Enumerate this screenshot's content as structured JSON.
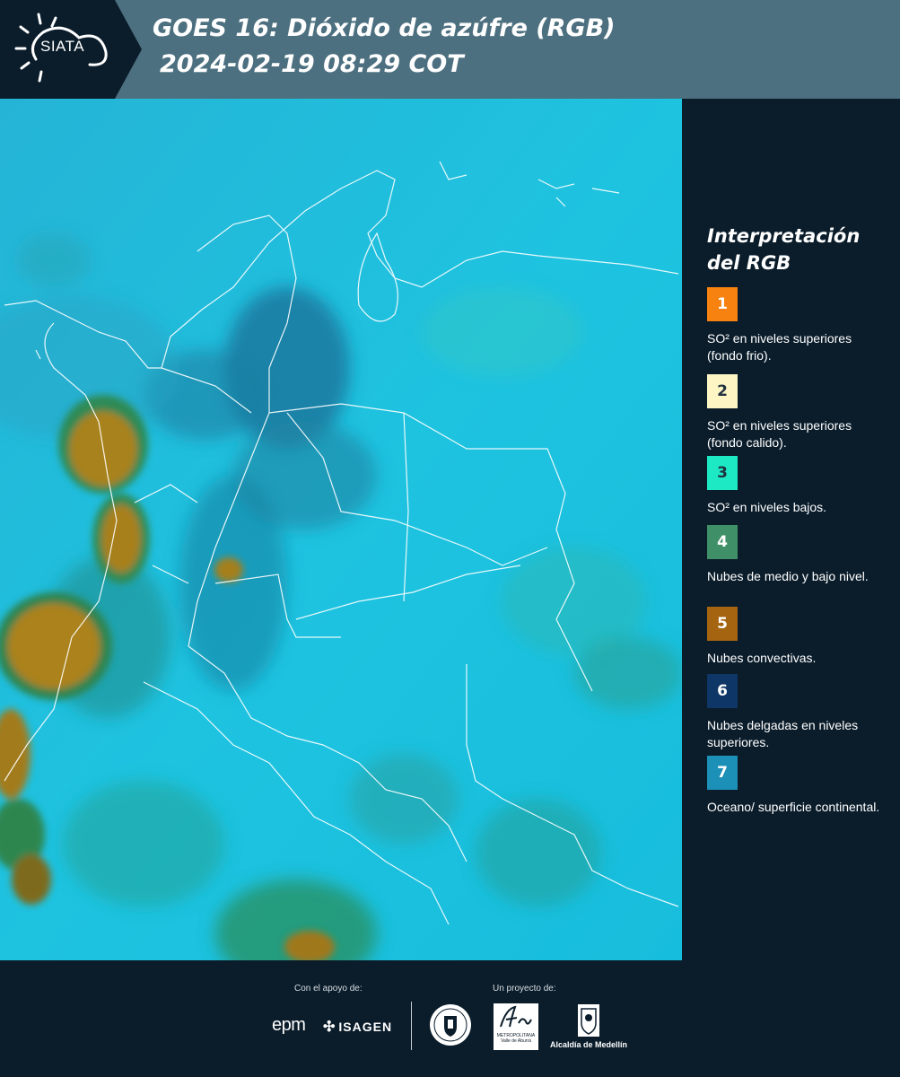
{
  "header": {
    "logo_text": "SIATA",
    "title_line1": "GOES 16: Dióxido de azúfre (RGB)",
    "title_line2": "2024-02-19 08:29 COT"
  },
  "legend": {
    "title_line1": "Interpretación",
    "title_line2": "del RGB",
    "items": [
      {
        "num": "1",
        "color": "#f7820f",
        "desc": "SO² en niveles superiores (fondo frio)."
      },
      {
        "num": "2",
        "color": "#fdf6c4",
        "desc": "SO² en niveles superiores (fondo calido)."
      },
      {
        "num": "3",
        "color": "#1de9c4",
        "desc": "SO² en niveles bajos."
      },
      {
        "num": "4",
        "color": "#3f9068",
        "desc": "Nubes de medio y bajo nivel."
      },
      {
        "num": "5",
        "color": "#a46410",
        "desc": "Nubes convectivas."
      },
      {
        "num": "6",
        "color": "#0e3666",
        "desc": "Nubes delgadas en niveles superiores."
      },
      {
        "num": "7",
        "color": "#1c90b6",
        "desc": "Oceano/ superficie continental."
      }
    ]
  },
  "footer": {
    "support_label": "Con el apoyo de:",
    "project_label": "Un proyecto de:",
    "sponsor_1": "epm",
    "sponsor_2": "ISAGEN",
    "partner_1_line1": "METROPOLITANA",
    "partner_1_line2": "Valle de Aburrá",
    "partner_2": "Alcaldía de Medellín"
  },
  "colors": {
    "header_bg": "#4d7080",
    "logo_bg": "#0b1d2b",
    "sidebar_bg": "#0b1d2b",
    "map_ocean": "#1fbfde"
  }
}
